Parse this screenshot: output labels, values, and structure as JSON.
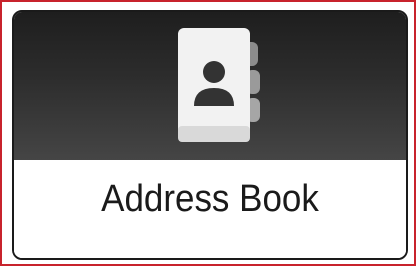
{
  "tile": {
    "label": "Address Book",
    "icon": "address-book-icon"
  },
  "colors": {
    "frame_border": "#c8232c",
    "tile_top": "#2d2d2d",
    "tile_bottom": "#ffffff",
    "label_text": "#1a1a1a"
  }
}
